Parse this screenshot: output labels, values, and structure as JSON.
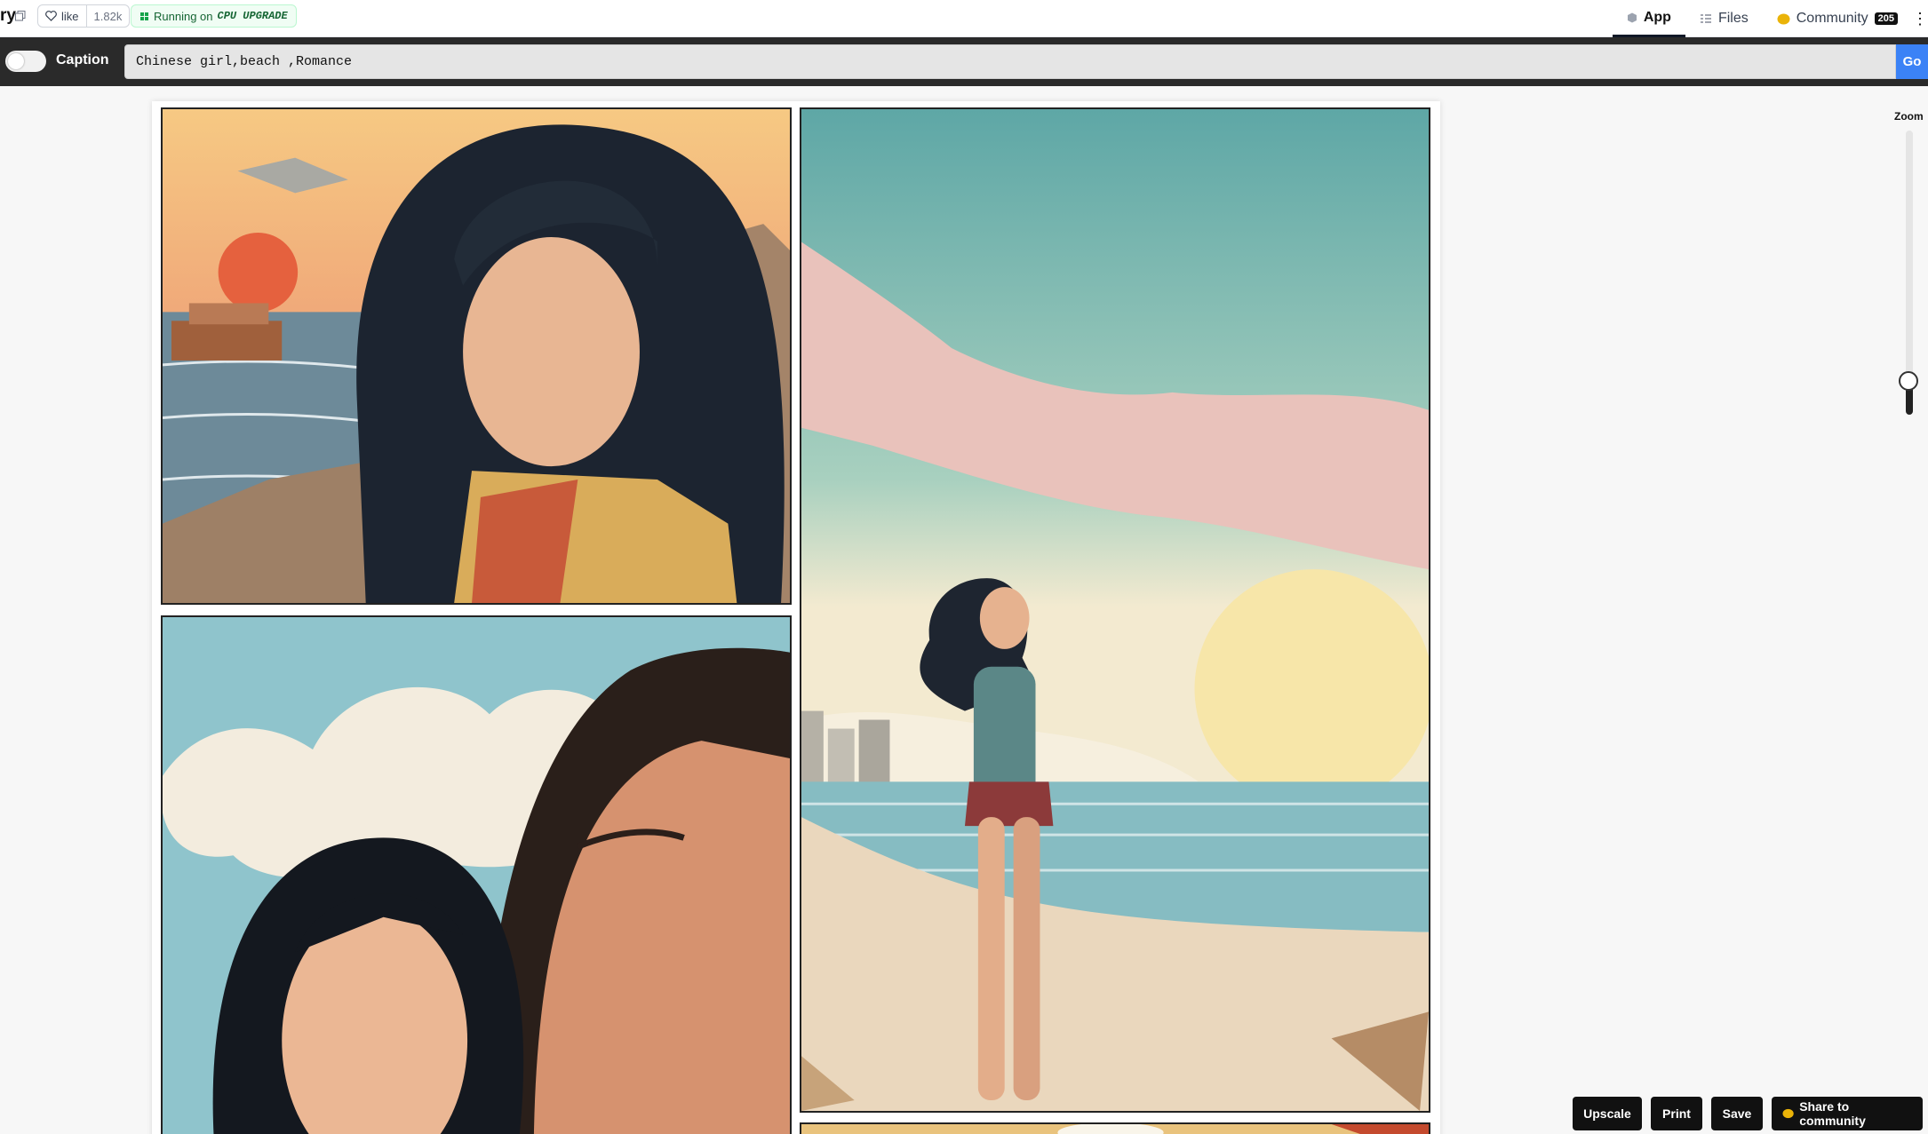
{
  "header": {
    "title_fragment": "ry",
    "like_label": "like",
    "like_count": "1.82k",
    "running_prefix": "Running on",
    "hardware": "CPU UPGRADE",
    "nav": {
      "app": "App",
      "files": "Files",
      "community": "Community",
      "community_count": "205"
    }
  },
  "caption": {
    "toggle_label": "Caption",
    "prompt": "Chinese girl,beach ,Romance",
    "go_label": "Go"
  },
  "zoom": {
    "label": "Zoom",
    "level": 0.12
  },
  "actions": {
    "upscale": "Upscale",
    "print": "Print",
    "save": "Save",
    "share": "Share to community"
  },
  "colors": {
    "accent": "#3b82f6",
    "running_green": "#166534",
    "dark_bar": "#2a2a2a"
  }
}
